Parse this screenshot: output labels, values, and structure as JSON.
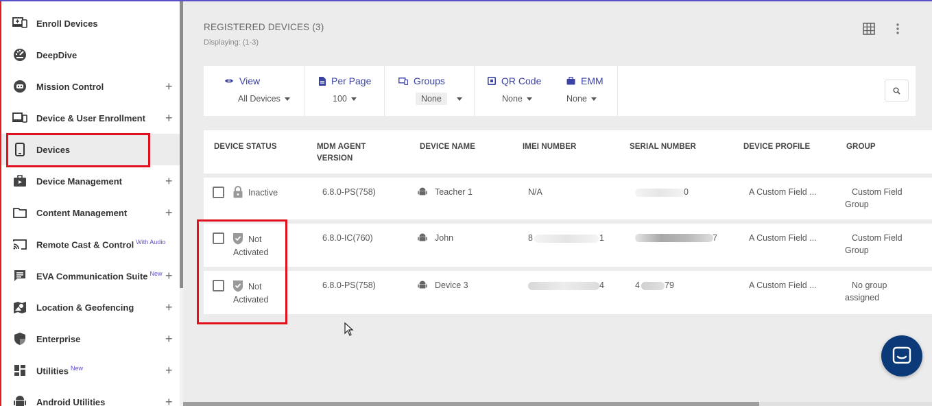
{
  "sidebar": {
    "items": [
      {
        "label": "Enroll Devices",
        "icon": "enroll-devices-icon",
        "plus": false,
        "sup": ""
      },
      {
        "label": "DeepDive",
        "icon": "speedometer-icon",
        "plus": false,
        "sup": ""
      },
      {
        "label": "Mission Control",
        "icon": "mission-control-icon",
        "plus": true,
        "sup": ""
      },
      {
        "label": "Device & User Enrollment",
        "icon": "device-user-icon",
        "plus": true,
        "sup": ""
      },
      {
        "label": "Devices",
        "icon": "phone-icon",
        "plus": false,
        "sup": ""
      },
      {
        "label": "Device Management",
        "icon": "briefcase-icon",
        "plus": true,
        "sup": ""
      },
      {
        "label": "Content Management",
        "icon": "folder-icon",
        "plus": true,
        "sup": ""
      },
      {
        "label": "Remote Cast & Control",
        "icon": "cast-icon",
        "plus": false,
        "sup": "With Audio"
      },
      {
        "label": "EVA Communication Suite",
        "icon": "chat-bubble-icon",
        "plus": true,
        "sup": "New"
      },
      {
        "label": "Location & Geofencing",
        "icon": "map-icon",
        "plus": true,
        "sup": ""
      },
      {
        "label": "Enterprise",
        "icon": "shield-icon",
        "plus": true,
        "sup": ""
      },
      {
        "label": "Utilities",
        "icon": "dashboard-icon",
        "plus": true,
        "sup": "New"
      },
      {
        "label": "Android Utilities",
        "icon": "android-icon",
        "plus": true,
        "sup": ""
      }
    ],
    "plus_symbol": "+"
  },
  "header": {
    "title": "REGISTERED DEVICES (3)",
    "subtitle": "Displaying: (1-3)"
  },
  "toolbar": {
    "view": {
      "label": "View",
      "value": "All Devices"
    },
    "per_page": {
      "label": "Per Page",
      "value": "100"
    },
    "groups": {
      "label": "Groups",
      "value": "None"
    },
    "qr_code": {
      "label": "QR Code",
      "value": "None"
    },
    "emm": {
      "label": "EMM",
      "value": "None"
    }
  },
  "table": {
    "headers": {
      "status": "DEVICE STATUS",
      "mdm_line1": "MDM AGENT",
      "mdm_line2": "VERSION",
      "name": "DEVICE NAME",
      "imei": "IMEI NUMBER",
      "serial": "SERIAL NUMBER",
      "profile": "DEVICE PROFILE",
      "group": "GROUP"
    },
    "rows": [
      {
        "status_line1": "Inactive",
        "status_line2": "",
        "mdm": "6.8.0-PS(758)",
        "name": "Teacher 1",
        "imei": "N/A",
        "serial_end": "0",
        "profile": "A Custom Field ...",
        "group_line1": "Custom Field",
        "group_line2": "Group"
      },
      {
        "status_line1": "Not",
        "status_line2": "Activated",
        "mdm": "6.8.0-IC(760)",
        "name": "John",
        "imei_start": "8",
        "imei_end": "1",
        "serial_end": "7",
        "profile": "A Custom Field ...",
        "group_line1": "Custom Field",
        "group_line2": "Group"
      },
      {
        "status_line1": "Not",
        "status_line2": "Activated",
        "mdm": "6.8.0-PS(758)",
        "name": "Device 3",
        "imei_end": "4",
        "serial_start": "4",
        "serial_end": "79",
        "profile": "A Custom Field ...",
        "group_line1": "No group",
        "group_line2": "assigned"
      }
    ]
  },
  "colors": {
    "accent": "#3b43a5",
    "highlight": "#e0101e",
    "chat": "#0c3a78"
  }
}
